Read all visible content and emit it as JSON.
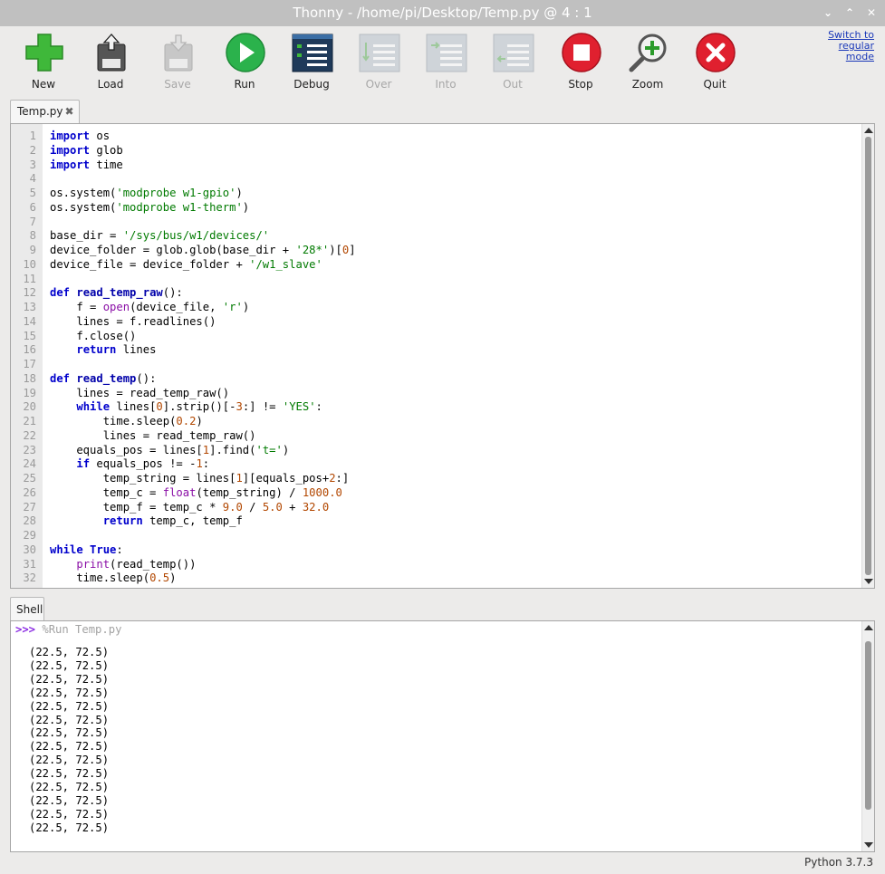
{
  "window": {
    "title": "Thonny  -  /home/pi/Desktop/Temp.py  @  4 : 1"
  },
  "toolbar": {
    "buttons": [
      {
        "label": "New",
        "icon": "new-file-plus-icon",
        "enabled": true
      },
      {
        "label": "Load",
        "icon": "load-file-icon",
        "enabled": true
      },
      {
        "label": "Save",
        "icon": "save-icon",
        "enabled": false
      },
      {
        "label": "Run",
        "icon": "run-play-icon",
        "enabled": true
      },
      {
        "label": "Debug",
        "icon": "debug-icon",
        "enabled": true
      },
      {
        "label": "Over",
        "icon": "step-over-icon",
        "enabled": false
      },
      {
        "label": "Into",
        "icon": "step-into-icon",
        "enabled": false
      },
      {
        "label": "Out",
        "icon": "step-out-icon",
        "enabled": false
      },
      {
        "label": "Stop",
        "icon": "stop-icon",
        "enabled": true
      },
      {
        "label": "Zoom",
        "icon": "zoom-icon",
        "enabled": true
      },
      {
        "label": "Quit",
        "icon": "quit-icon",
        "enabled": true
      }
    ],
    "switch_mode": "Switch to regular mode"
  },
  "editor": {
    "tab_label": "Temp.py",
    "code_lines": [
      "import os",
      "import glob",
      "import time",
      "",
      "os.system('modprobe w1-gpio')",
      "os.system('modprobe w1-therm')",
      "",
      "base_dir = '/sys/bus/w1/devices/'",
      "device_folder = glob.glob(base_dir + '28*')[0]",
      "device_file = device_folder + '/w1_slave'",
      "",
      "def read_temp_raw():",
      "    f = open(device_file, 'r')",
      "    lines = f.readlines()",
      "    f.close()",
      "    return lines",
      "",
      "def read_temp():",
      "    lines = read_temp_raw()",
      "    while lines[0].strip()[-3:] != 'YES':",
      "        time.sleep(0.2)",
      "        lines = read_temp_raw()",
      "    equals_pos = lines[1].find('t=')",
      "    if equals_pos != -1:",
      "        temp_string = lines[1][equals_pos+2:]",
      "        temp_c = float(temp_string) / 1000.0",
      "        temp_f = temp_c * 9.0 / 5.0 + 32.0",
      "        return temp_c, temp_f",
      "",
      "while True:",
      "    print(read_temp())",
      "    time.sleep(0.5)"
    ]
  },
  "shell": {
    "tab_label": "Shell",
    "prompt": ">>>",
    "command": "%Run Temp.py",
    "output_lines": [
      "(22.5, 72.5)",
      "(22.5, 72.5)",
      "(22.5, 72.5)",
      "(22.5, 72.5)",
      "(22.5, 72.5)",
      "(22.5, 72.5)",
      "(22.5, 72.5)",
      "(22.5, 72.5)",
      "(22.5, 72.5)",
      "(22.5, 72.5)",
      "(22.5, 72.5)",
      "(22.5, 72.5)",
      "(22.5, 72.5)",
      "(22.5, 72.5)"
    ]
  },
  "status": {
    "python_version": "Python 3.7.3"
  },
  "colors": {
    "keyword": "#0000cc",
    "string": "#007a00",
    "number": "#b24700",
    "builtin": "#8a0ea6",
    "prompt": "#8a2be2",
    "link": "#1a38b8"
  }
}
